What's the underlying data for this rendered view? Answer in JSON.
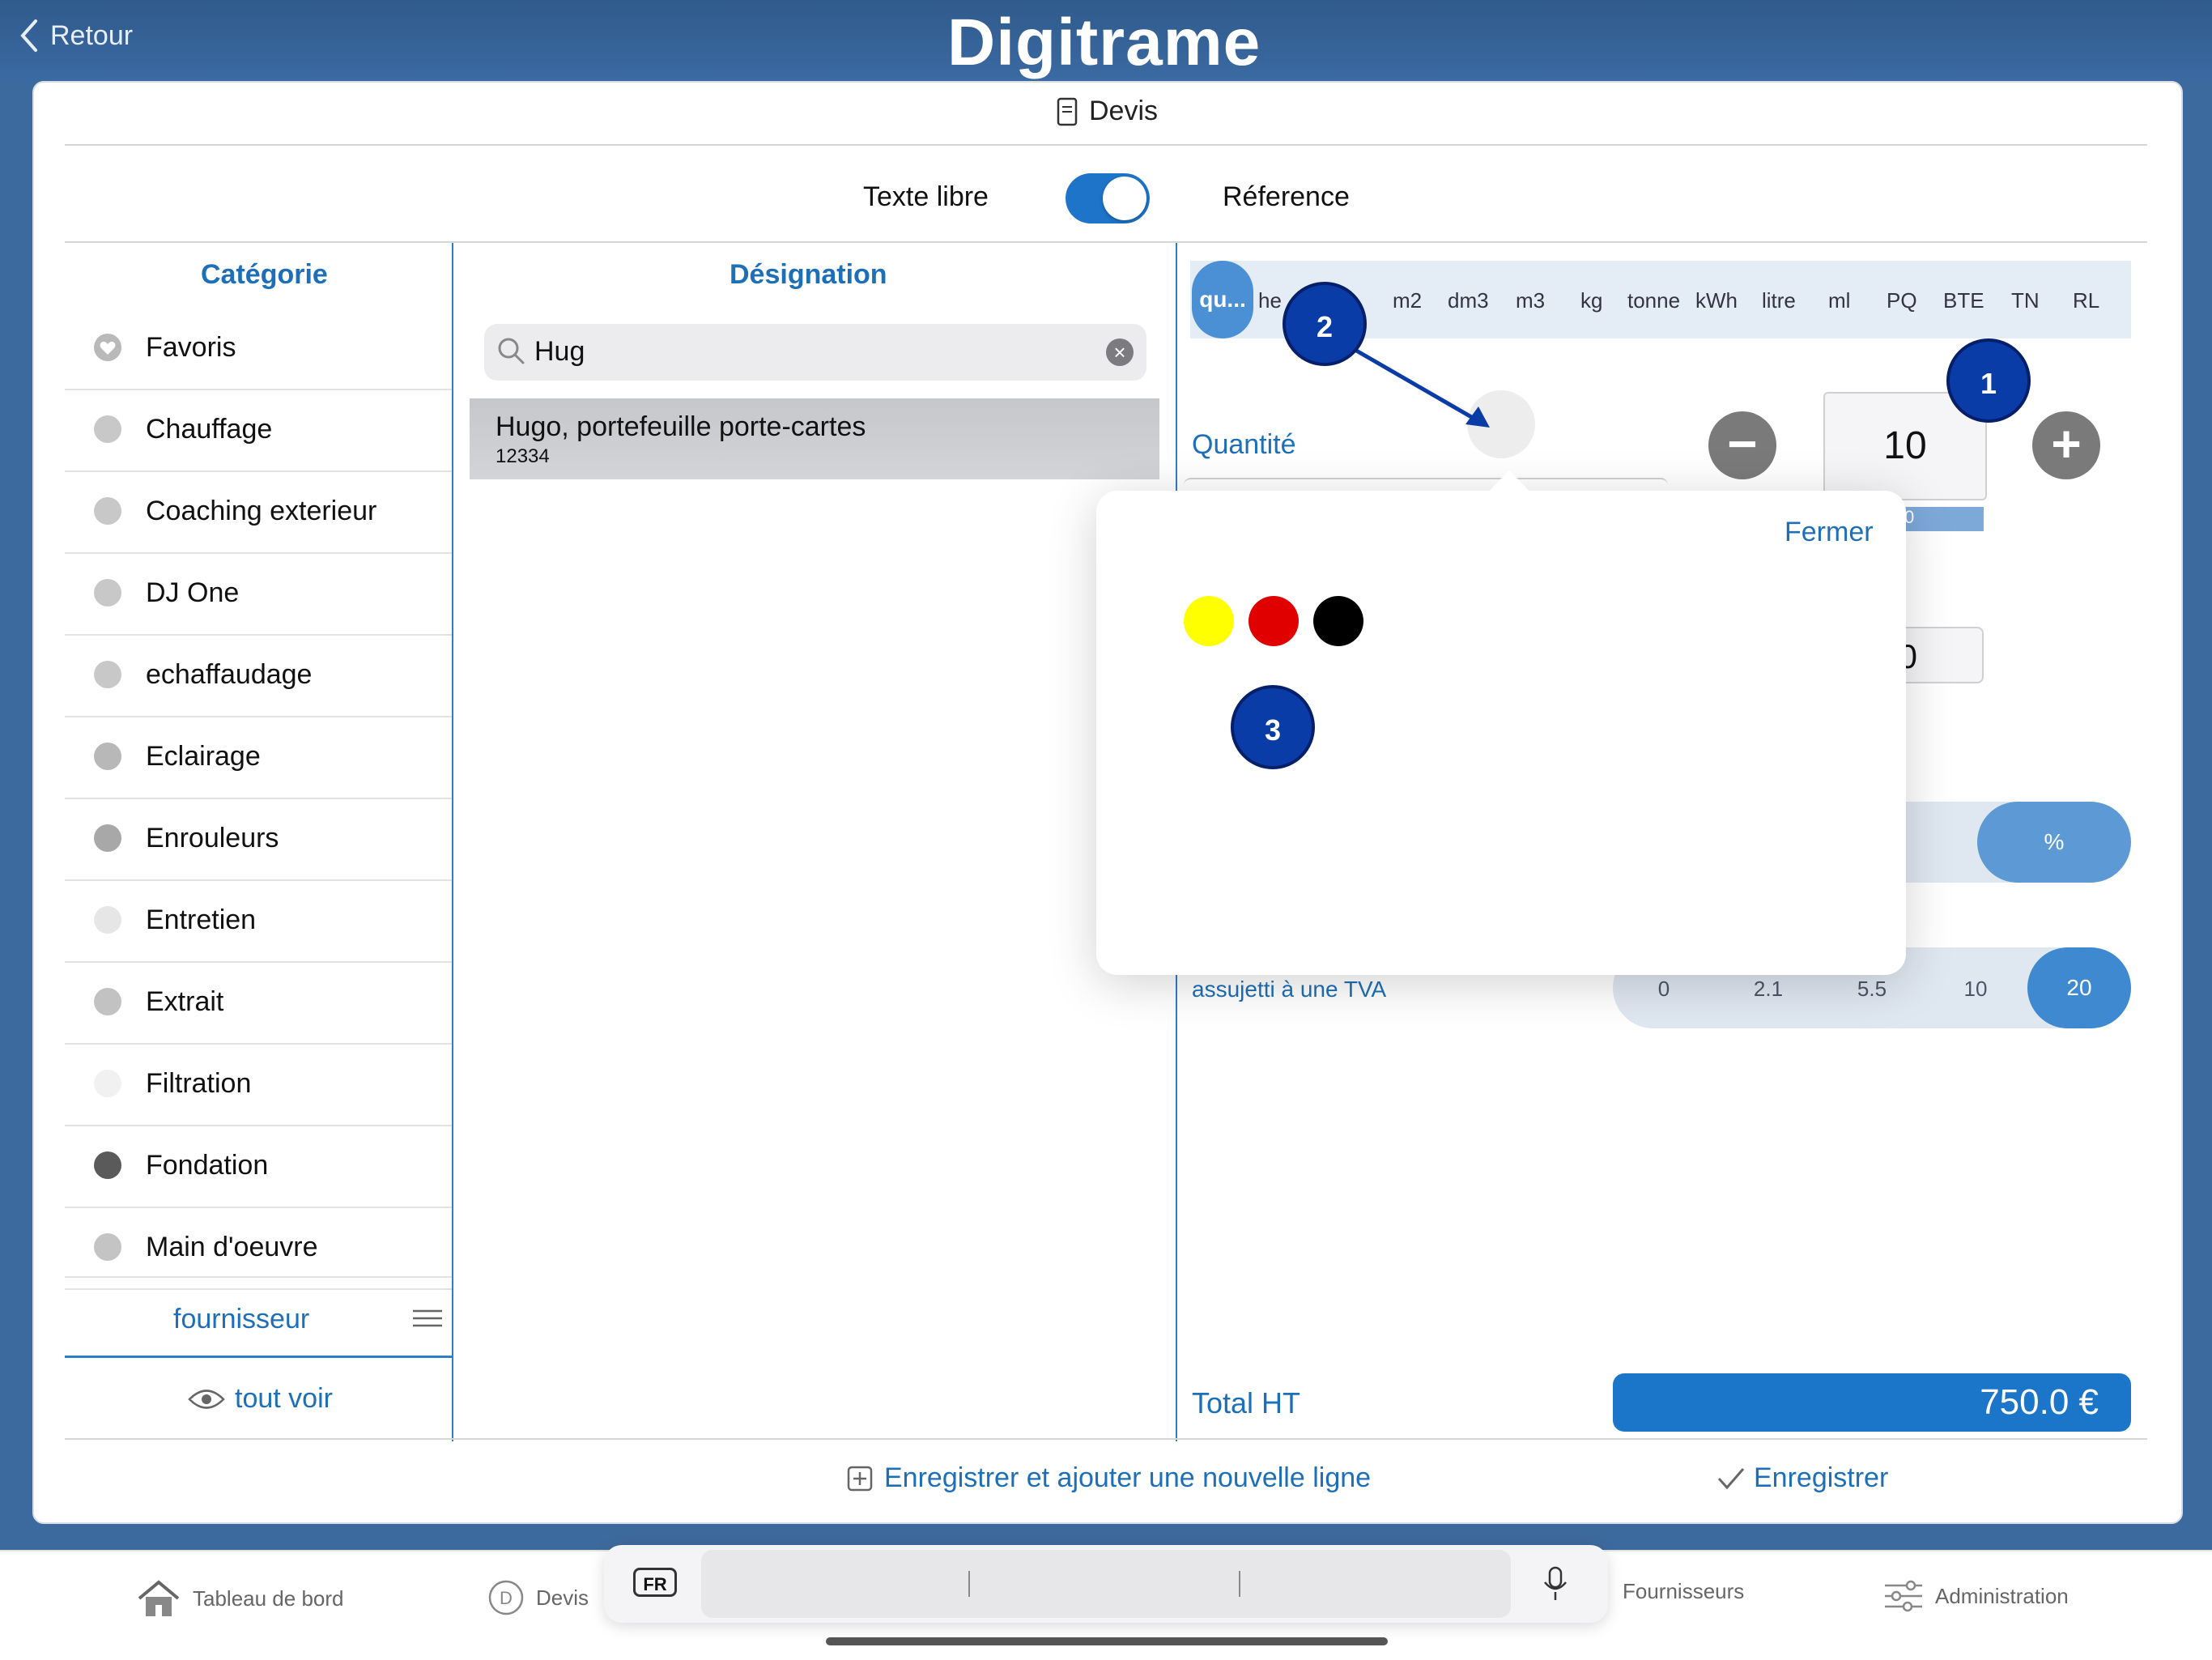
{
  "header": {
    "back_label": "Retour",
    "logo": "Digitrame"
  },
  "card": {
    "title": "Devis"
  },
  "toggle_row": {
    "left_label": "Texte libre",
    "right_label": "Réference",
    "enabled": true
  },
  "categories": {
    "header": "Catégorie",
    "items": [
      {
        "label": "Favoris",
        "dot": "#b9b9b9",
        "heart": true
      },
      {
        "label": "Chauffage",
        "dot": "#c8c8c8"
      },
      {
        "label": "Coaching exterieur",
        "dot": "#c8c8c8"
      },
      {
        "label": "DJ One",
        "dot": "#c8c8c8"
      },
      {
        "label": "echaffaudage",
        "dot": "#c8c8c8"
      },
      {
        "label": "Eclairage",
        "dot": "#b8b8b8"
      },
      {
        "label": "Enrouleurs",
        "dot": "#a8a8a8"
      },
      {
        "label": "Entretien",
        "dot": "#e6e6e6"
      },
      {
        "label": "Extrait",
        "dot": "#c2c2c2"
      },
      {
        "label": "Filtration",
        "dot": "#f1f1f1"
      },
      {
        "label": "Fondation",
        "dot": "#5a5a5a"
      },
      {
        "label": "Main d'oeuvre",
        "dot": "#c4c4c4"
      }
    ],
    "fournisseur": "fournisseur",
    "tout_voir": "tout voir"
  },
  "designation": {
    "header": "Désignation",
    "search_value": "Hug",
    "result": {
      "name": "Hugo, portefeuille porte-cartes",
      "code": "12334"
    }
  },
  "units": {
    "selected": "qu...",
    "items": [
      "he",
      "m2",
      "dm3",
      "m3",
      "kg",
      "tonne",
      "kWh",
      "litre",
      "ml",
      "PQ",
      "BTE",
      "TN",
      "RL"
    ]
  },
  "quantity": {
    "label": "Quantité",
    "value": "10",
    "bar_text": "0"
  },
  "price": {
    "visible_text": ".0"
  },
  "discount": {
    "label": "%"
  },
  "tva": {
    "label": "assujetti à une TVA",
    "options": [
      "0",
      "2.1",
      "5.5",
      "10",
      "20"
    ],
    "selected": "20"
  },
  "total": {
    "label": "Total HT",
    "value": "750.0  €"
  },
  "actions": {
    "save_add": "Enregistrer et ajouter une nouvelle ligne",
    "save": "Enregistrer"
  },
  "popover": {
    "close_label": "Fermer",
    "colors": [
      "#ffff00",
      "#e00000",
      "#000000"
    ]
  },
  "markers": [
    "1",
    "2",
    "3"
  ],
  "tabbar": {
    "items": [
      {
        "label": "Tableau de bord",
        "icon": "house-icon"
      },
      {
        "label": "Devis",
        "icon": "d-circle-icon"
      },
      {
        "label": "Fournisseurs",
        "icon": ""
      },
      {
        "label": "Administration",
        "icon": "sliders-icon"
      }
    ],
    "keyboard_lang": "FR"
  },
  "accent_color": "#1d74c9"
}
